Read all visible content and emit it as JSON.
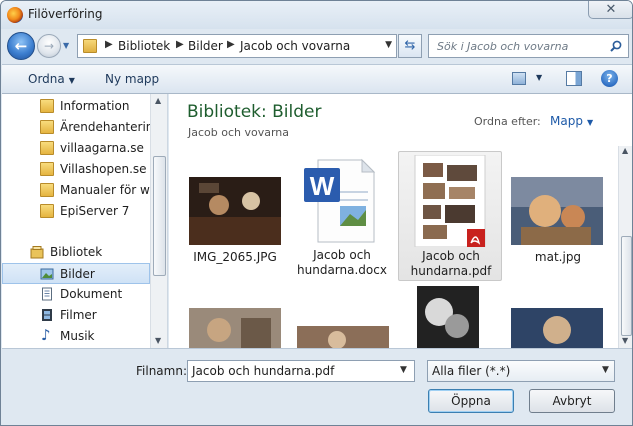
{
  "window": {
    "title": "Filöverföring",
    "close_label": "✕"
  },
  "address_bar": {
    "crumbs": [
      "Bibliotek",
      "Bilder",
      "Jacob och vovarna"
    ],
    "search_placeholder": "Sök i Jacob och vovarna"
  },
  "toolbar": {
    "organize": "Ordna",
    "new_folder": "Ny mapp"
  },
  "nav": {
    "folders": [
      "Information",
      "Ärendehantering",
      "villaagarna.se",
      "Villashopen.se",
      "Manualer för wel",
      "EpiServer 7"
    ],
    "library_header": "Bibliotek",
    "libraries": [
      {
        "label": "Bilder",
        "icon": "pictures-icon",
        "selected": true
      },
      {
        "label": "Dokument",
        "icon": "documents-icon",
        "selected": false
      },
      {
        "label": "Filmer",
        "icon": "videos-icon",
        "selected": false
      },
      {
        "label": "Musik",
        "icon": "music-icon",
        "selected": false
      }
    ]
  },
  "content": {
    "title": "Bibliotek: Bilder",
    "subtitle": "Jacob och vovarna",
    "arrange_label": "Ordna efter:",
    "arrange_value": "Mapp",
    "files": [
      {
        "name": "IMG_2065.JPG",
        "kind": "photo",
        "selected": false
      },
      {
        "name": "Jacob och hundarna.docx",
        "kind": "word-document",
        "selected": false
      },
      {
        "name": "Jacob och hundarna.pdf",
        "kind": "pdf-document",
        "selected": true
      },
      {
        "name": "mat.jpg",
        "kind": "photo",
        "selected": false
      }
    ]
  },
  "bottom": {
    "filename_label": "Filnamn:",
    "filename_value": "Jacob och hundarna.pdf",
    "filetype_value": "Alla filer (*.*)",
    "open_button": "Öppna",
    "cancel_button": "Avbryt"
  }
}
